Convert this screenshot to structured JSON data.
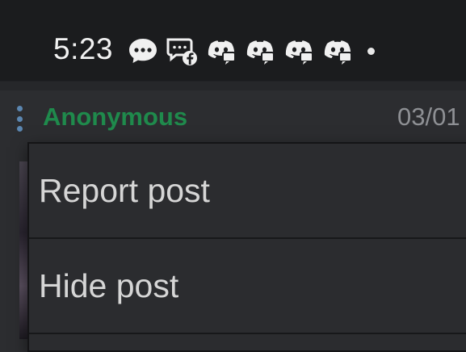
{
  "status_bar": {
    "time": "5:23",
    "icons": [
      "messenger-icon",
      "facebook-messages-icon",
      "discord-icon",
      "discord-icon",
      "discord-icon",
      "discord-icon"
    ]
  },
  "post": {
    "poster_name": "Anonymous",
    "date": "03/01"
  },
  "menu": {
    "items": [
      {
        "label": "Report post"
      },
      {
        "label": "Hide post"
      }
    ]
  },
  "colors": {
    "poster_name": "#1f8a4c",
    "kebab": "#5b86b0",
    "menu_bg": "#2b2c2f",
    "status_bar_bg": "#1b1c1e"
  }
}
